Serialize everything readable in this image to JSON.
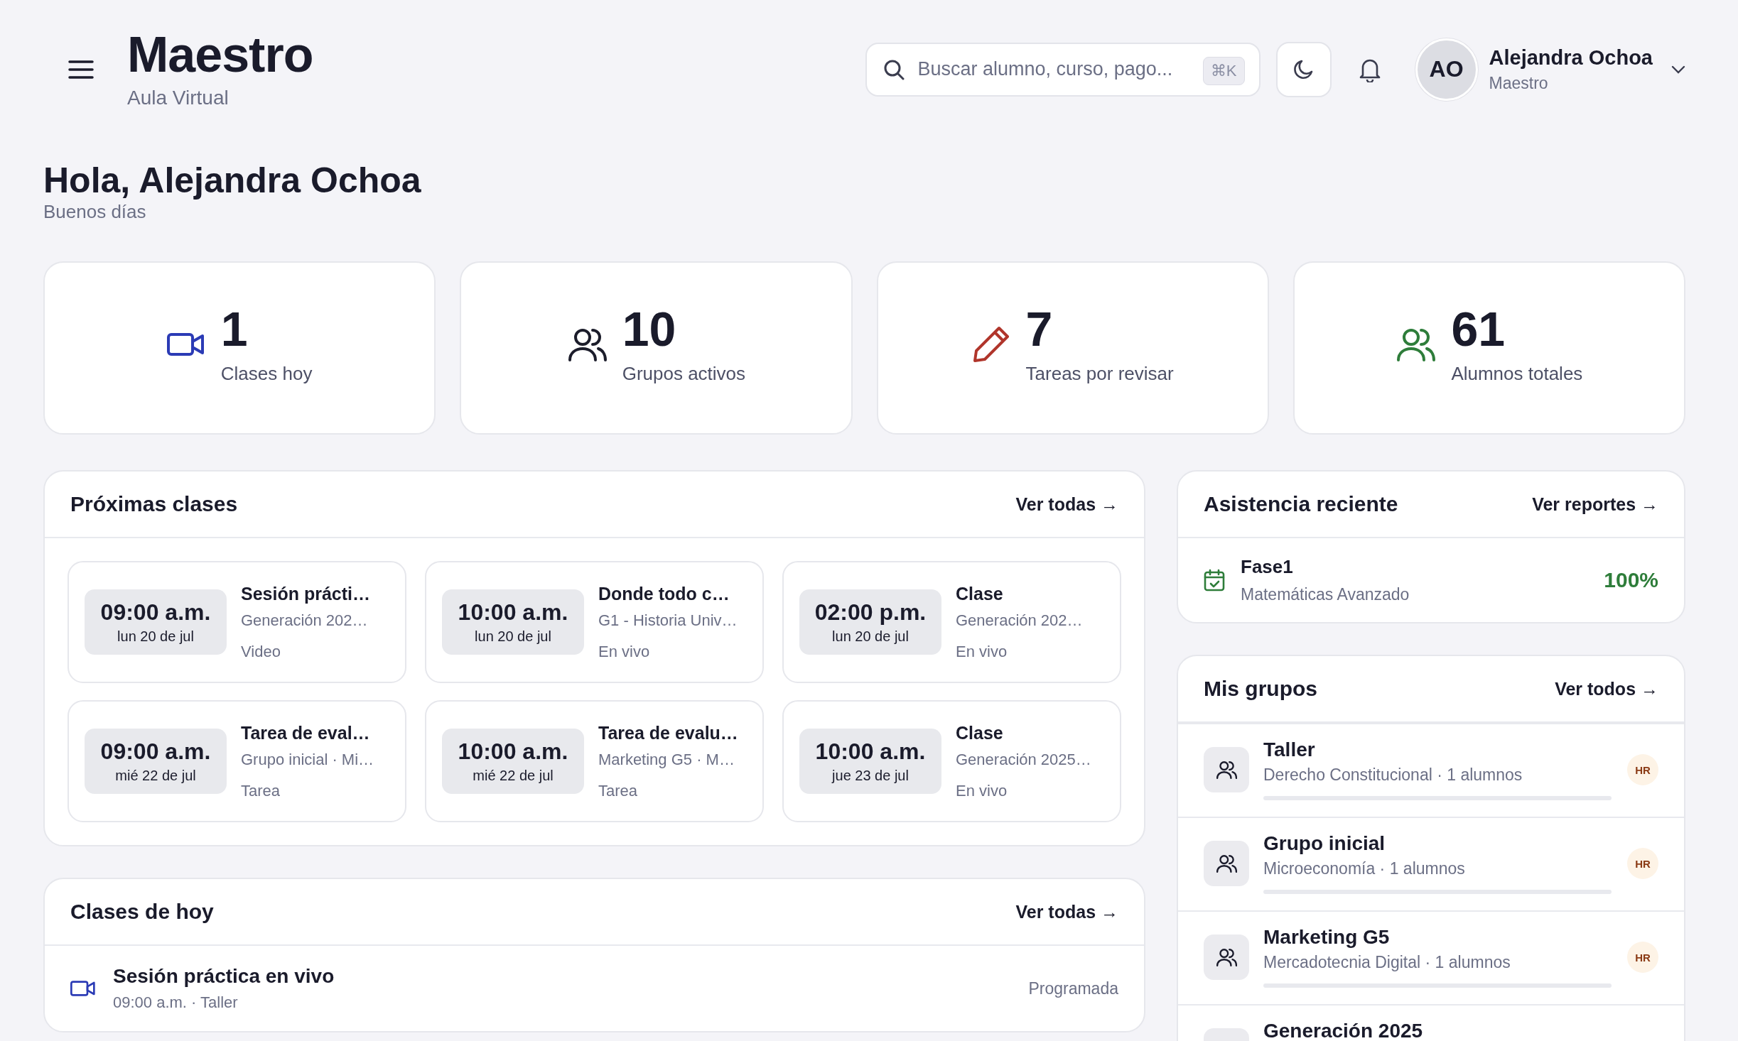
{
  "header": {
    "title": "Maestro",
    "subtitle": "Aula Virtual",
    "search": {
      "placeholder": "Buscar alumno, curso, pago...",
      "shortcut": "⌘K"
    },
    "user": {
      "initials": "AO",
      "name": "Alejandra Ochoa",
      "role": "Maestro"
    }
  },
  "greeting": {
    "title": "Hola, Alejandra Ochoa",
    "subtitle": "Buenos días"
  },
  "stats": [
    {
      "value": "1",
      "label": "Clases hoy",
      "color": "#2b3bb5"
    },
    {
      "value": "10",
      "label": "Grupos activos",
      "color": "#1c1d2b"
    },
    {
      "value": "7",
      "label": "Tareas por revisar",
      "color": "#b0352b"
    },
    {
      "value": "61",
      "label": "Alumnos totales",
      "color": "#2e7d3a"
    }
  ],
  "upcoming": {
    "title": "Próximas clases",
    "link": "Ver todas →",
    "classes": [
      {
        "time": "09:00 a.m.",
        "date": "lun 20 de jul",
        "title": "Sesión prácti…",
        "group": "Generación 202…",
        "mode": "Video"
      },
      {
        "time": "10:00 a.m.",
        "date": "lun 20 de jul",
        "title": "Donde todo c…",
        "group": "G1 - Historia Univ…",
        "mode": "En vivo"
      },
      {
        "time": "02:00 p.m.",
        "date": "lun 20 de jul",
        "title": "Clase",
        "group": "Generación 202…",
        "mode": "En vivo"
      },
      {
        "time": "09:00 a.m.",
        "date": "mié 22 de jul",
        "title": "Tarea de eval…",
        "group": "Grupo inicial · Mi…",
        "mode": "Tarea"
      },
      {
        "time": "10:00 a.m.",
        "date": "mié 22 de jul",
        "title": "Tarea de evalu…",
        "group": "Marketing G5 · M…",
        "mode": "Tarea"
      },
      {
        "time": "10:00 a.m.",
        "date": "jue 23 de jul",
        "title": "Clase",
        "group": "Generación 2025…",
        "mode": "En vivo"
      }
    ]
  },
  "today": {
    "title": "Clases de hoy",
    "link": "Ver todas →",
    "items": [
      {
        "title": "Sesión práctica en vivo",
        "detail": "09:00 a.m. · Taller",
        "status": "Programada"
      }
    ]
  },
  "attendance": {
    "title": "Asistencia reciente",
    "link": "Ver reportes →",
    "items": [
      {
        "name": "Fase1",
        "course": "Matemáticas Avanzado",
        "percent": "100%"
      }
    ]
  },
  "groups": {
    "title": "Mis grupos",
    "link": "Ver todos →",
    "items": [
      {
        "name": "Taller",
        "detail": "Derecho Constitucional · 1 alumnos",
        "badge": "HR",
        "level": 0
      },
      {
        "name": "Grupo inicial",
        "detail": "Microeconomía · 1 alumnos",
        "badge": "HR",
        "level": 0
      },
      {
        "name": "Marketing G5",
        "detail": "Mercadotecnia Digital · 1 alumnos",
        "badge": "HR",
        "level": 0
      },
      {
        "name": "Generación 2025"
      }
    ]
  }
}
